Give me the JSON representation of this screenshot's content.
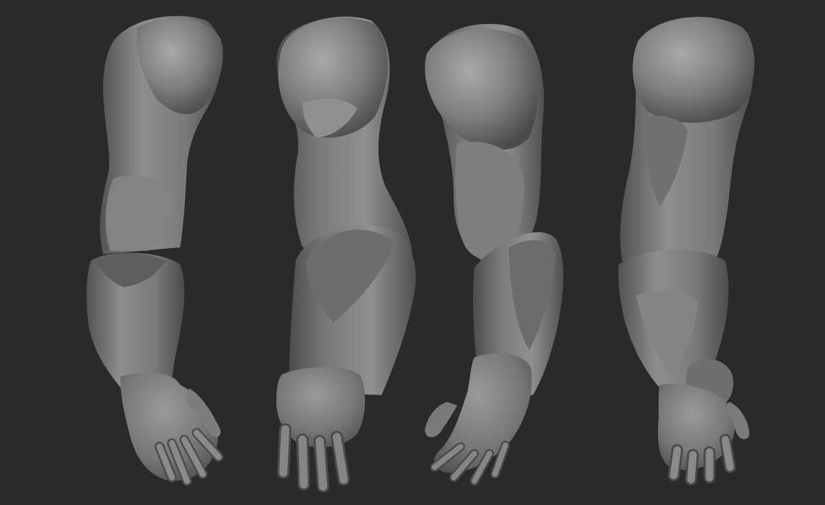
{
  "scene": {
    "background_color": "#2a2a2a",
    "material_base_color": "#7b7b7b",
    "material_highlight_color": "#a9a9a9",
    "material_shadow_color": "#444444"
  },
  "views": [
    {
      "id": "arm-view-front-right"
    },
    {
      "id": "arm-view-back"
    },
    {
      "id": "arm-view-front-left"
    },
    {
      "id": "arm-view-side"
    }
  ]
}
